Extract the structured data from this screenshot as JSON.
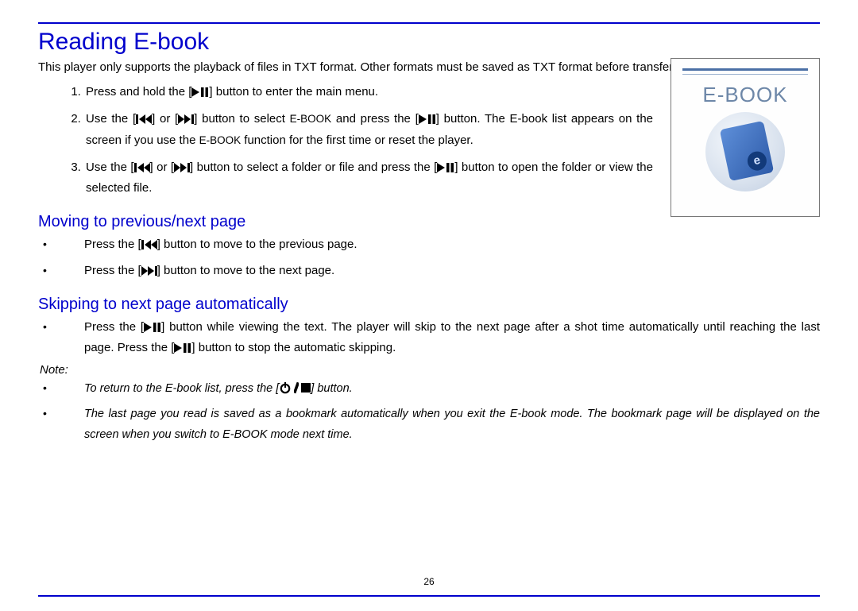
{
  "page_number": "26",
  "title": "Reading E-book",
  "intro": "This player only supports the playback of files in TXT format. Other formats must be saved as TXT format before transfer.",
  "steps": {
    "s1": {
      "pre": "Press and hold the [",
      "post": "] button to enter the main menu."
    },
    "s2": {
      "a": "Use the [",
      "b": "] or [",
      "c": "] button to select ",
      "d": " and press the [",
      "e": "] button. The E-book list appears on the screen if you use the ",
      "f": " function for the first time or reset the player.",
      "ebook1": "E-BOOK",
      "ebook2": "E-BOOK"
    },
    "s3": {
      "a": "Use the [",
      "b": "] or [",
      "c": "] button to select a folder or file and press the [",
      "d": "] button to open the folder or view the selected file."
    }
  },
  "sub_move": "Moving to previous/next page",
  "move": {
    "b1": {
      "a": "Press the [",
      "b": "] button to move to the previous page."
    },
    "b2": {
      "a": "Press the [",
      "b": "] button to move to the next page."
    }
  },
  "sub_skip": "Skipping to next page automatically",
  "skip": {
    "a": "Press the [",
    "b": "] button while viewing the text. The player will skip to the next page after a shot time automatically until reaching the last page. Press the [",
    "c": "] button to stop the automatic skipping."
  },
  "note_label": "Note:",
  "notes": {
    "n1": {
      "a": "To return to the E-book list, press the [",
      "b": "] button."
    },
    "n2": "The last page you read is saved as a bookmark automatically when you exit the E-book mode. The bookmark page will be displayed on the screen when you switch to E-BOOK mode next time."
  },
  "figure": {
    "label": "E-BOOK",
    "e": "e"
  }
}
